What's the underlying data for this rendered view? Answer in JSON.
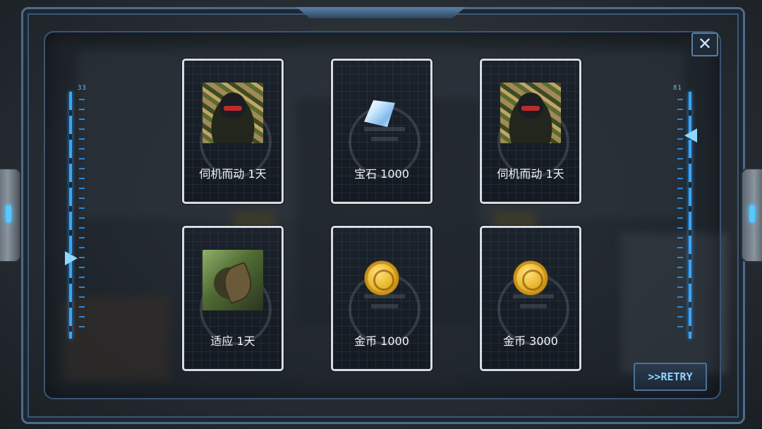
{
  "close_symbol": "✕",
  "retry_label": ">>RETRY",
  "gauges": {
    "left_value": "33",
    "right_value": "81"
  },
  "rewards": [
    {
      "label": "伺机而动 1天",
      "icon": "soldier-portrait"
    },
    {
      "label": "宝石 1000",
      "icon": "gem-icon"
    },
    {
      "label": "伺机而动 1天",
      "icon": "soldier-portrait"
    },
    {
      "label": "适应 1天",
      "icon": "moth-portrait"
    },
    {
      "label": "金币 1000",
      "icon": "gold-coin-icon"
    },
    {
      "label": "金币 3000",
      "icon": "gold-coin-icon"
    }
  ],
  "colors": {
    "accent": "#36a6ff",
    "card_border": "#d7dde3",
    "retry_text": "#8fd2ff"
  }
}
